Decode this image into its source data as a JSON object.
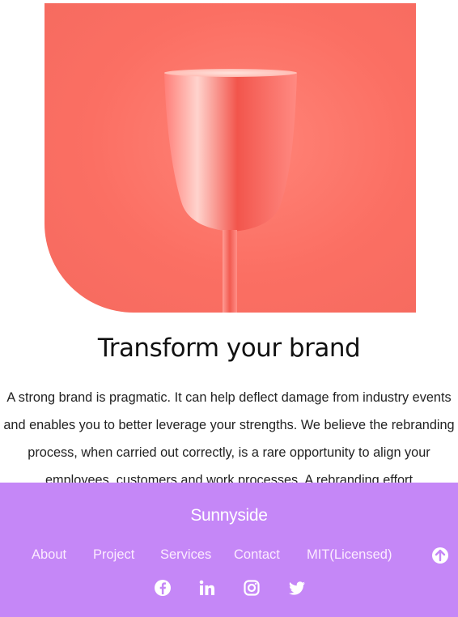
{
  "hero": {
    "image_alt": "pink goblet on coral background"
  },
  "section": {
    "title": "Transform your brand",
    "body": "A strong brand is pragmatic. It can help deflect damage from industry events and enables you to better leverage your strengths. We believe the rebranding process, when carried out correctly, is a rare opportunity to align your employees, customers and work processes. A rebranding effort"
  },
  "footer": {
    "brand": "Sunnyside",
    "nav": [
      "About",
      "Project",
      "Services",
      "Contact",
      "MIT(Licensed)"
    ],
    "social": [
      "facebook-icon",
      "linkedin-icon",
      "instagram-icon",
      "twitter-icon"
    ],
    "scroll_top_icon": "arrow-up-icon",
    "background": "#c587f7"
  }
}
